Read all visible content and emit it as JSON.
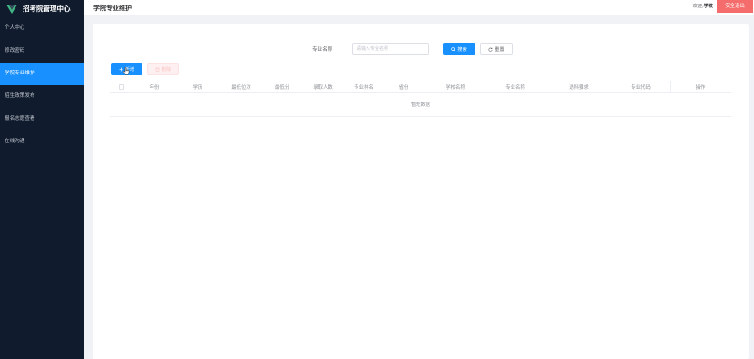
{
  "app": {
    "title": "招考院管理中心"
  },
  "sidebar": {
    "items": [
      {
        "label": "个人中心",
        "active": false
      },
      {
        "label": "修改密码",
        "active": false
      },
      {
        "label": "学院专业维护",
        "active": true
      },
      {
        "label": "招生政策发布",
        "active": false
      },
      {
        "label": "报名志愿查看",
        "active": false
      },
      {
        "label": "在线沟通",
        "active": false
      }
    ]
  },
  "header": {
    "page_title": "学院专业维护",
    "welcome_prefix": "欢迎,",
    "username": "学校",
    "logout_label": "安全退出"
  },
  "search": {
    "label": "专业名称",
    "placeholder": "请输入专业名称",
    "value": "",
    "search_label": "搜索",
    "reset_label": "重置"
  },
  "toolbar": {
    "add_label": "新增",
    "delete_label": "删除"
  },
  "table": {
    "columns": [
      "年份",
      "学历",
      "最低位次",
      "最低分",
      "录取人数",
      "专业排名",
      "省份",
      "学校名称",
      "专业名称",
      "选科要求",
      "专业代码",
      "操作"
    ],
    "empty_text": "暂无数据"
  },
  "colors": {
    "sidebar_bg": "#101c2e",
    "accent": "#1890ff",
    "danger": "#f56c6c",
    "logo_green": "#41b883"
  },
  "icons": [
    "vue-logo-icon",
    "search-icon",
    "refresh-icon",
    "plus-icon",
    "trash-icon",
    "pointer-cursor-icon"
  ]
}
